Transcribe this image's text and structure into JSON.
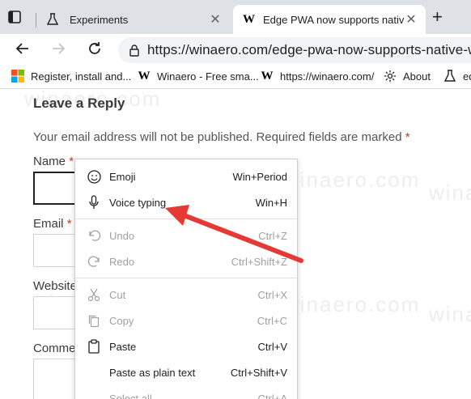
{
  "browser": {
    "tabs": [
      {
        "title": "Experiments",
        "active": false
      },
      {
        "title": "Edge PWA now supports native V",
        "active": true
      }
    ],
    "new_tab_glyph": "+",
    "close_glyph": "✕",
    "url": "https://winaero.com/edge-pwa-now-supports-native-wi",
    "bookmarks": [
      {
        "label": "Register, install and...",
        "icon": "microsoft-logo-icon"
      },
      {
        "label": "Winaero - Free sma...",
        "icon": "winaero-logo-icon"
      },
      {
        "label": "https://winaero.com/",
        "icon": "winaero-logo-icon"
      },
      {
        "label": "About",
        "icon": "gear-icon"
      },
      {
        "label": "ed",
        "icon": "flask-icon"
      }
    ]
  },
  "page": {
    "heading": "Leave a Reply",
    "note": "Your email address will not be published. Required fields are marked",
    "required_mark": "*",
    "labels": {
      "name": "Name",
      "email": "Email",
      "website": "Website",
      "comment": "Comme"
    },
    "watermark": "winaero.com"
  },
  "context_menu": {
    "items": [
      {
        "label": "Emoji",
        "shortcut": "Win+Period",
        "icon": "emoji-icon",
        "disabled": false
      },
      {
        "label": "Voice typing",
        "shortcut": "Win+H",
        "icon": "microphone-icon",
        "disabled": false
      },
      {
        "label": "Undo",
        "shortcut": "Ctrl+Z",
        "icon": "undo-icon",
        "disabled": true
      },
      {
        "label": "Redo",
        "shortcut": "Ctrl+Shift+Z",
        "icon": "redo-icon",
        "disabled": true
      },
      {
        "label": "Cut",
        "shortcut": "Ctrl+X",
        "icon": "cut-icon",
        "disabled": true
      },
      {
        "label": "Copy",
        "shortcut": "Ctrl+C",
        "icon": "copy-icon",
        "disabled": true
      },
      {
        "label": "Paste",
        "shortcut": "Ctrl+V",
        "icon": "paste-icon",
        "disabled": false
      },
      {
        "label": "Paste as plain text",
        "shortcut": "Ctrl+Shift+V",
        "icon": "",
        "disabled": false
      },
      {
        "label": "Select all",
        "shortcut": "Ctrl+A",
        "icon": "",
        "disabled": true
      }
    ]
  },
  "colors": {
    "annotation_arrow": "#e53935",
    "required": "#c0392b"
  }
}
